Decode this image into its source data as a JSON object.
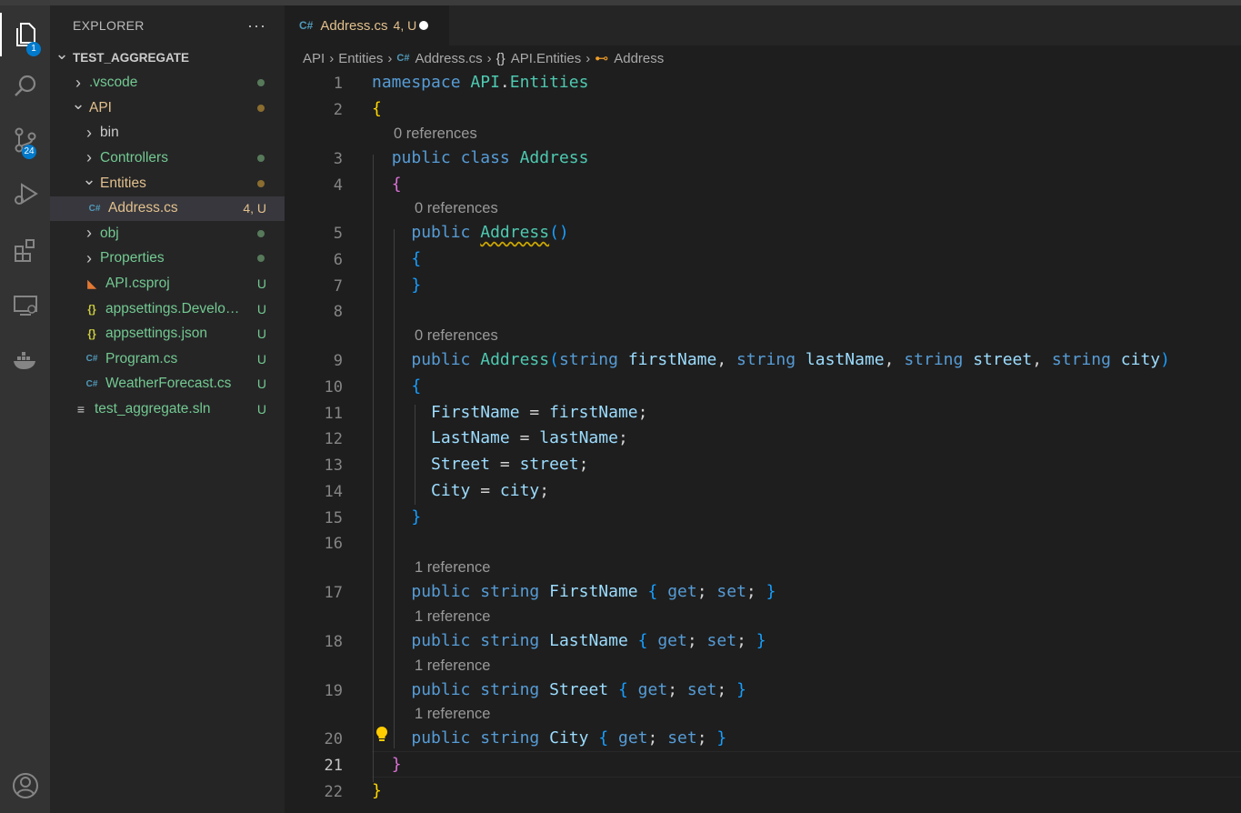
{
  "activity_bar": {
    "explorer_badge": "1",
    "scm_badge": "24"
  },
  "sidebar": {
    "title": "EXPLORER",
    "more": "···",
    "tree": [
      {
        "label": "TEST_AGGREGATE",
        "kind": "root",
        "chev": "down",
        "color": "#cccccc"
      },
      {
        "label": ".vscode",
        "kind": "folder",
        "chev": "right",
        "color": "#73c991",
        "dot": "#577a5a"
      },
      {
        "label": "API",
        "kind": "folder",
        "chev": "down",
        "color": "#e2c08d",
        "dot": "#8a6d2f"
      },
      {
        "label": "bin",
        "kind": "folder",
        "chev": "right",
        "color": "#cccccc"
      },
      {
        "label": "Controllers",
        "kind": "folder",
        "chev": "right",
        "color": "#73c991",
        "dot": "#577a5a"
      },
      {
        "label": "Entities",
        "kind": "folder",
        "chev": "down",
        "color": "#e2c08d",
        "dot": "#8a6d2f"
      },
      {
        "label": "Address.cs",
        "kind": "cs",
        "color": "#e2c08d",
        "status": "4, U",
        "status_color": "#e2c08d",
        "selected": true
      },
      {
        "label": "obj",
        "kind": "folder",
        "chev": "right",
        "color": "#73c991",
        "dot": "#577a5a"
      },
      {
        "label": "Properties",
        "kind": "folder",
        "chev": "right",
        "color": "#73c991",
        "dot": "#577a5a"
      },
      {
        "label": "API.csproj",
        "kind": "rss",
        "color": "#73c991",
        "status": "U",
        "status_color": "#73c991"
      },
      {
        "label": "appsettings.Develop...",
        "kind": "json",
        "color": "#73c991",
        "status": "U",
        "status_color": "#73c991"
      },
      {
        "label": "appsettings.json",
        "kind": "json",
        "color": "#73c991",
        "status": "U",
        "status_color": "#73c991"
      },
      {
        "label": "Program.cs",
        "kind": "cs",
        "color": "#73c991",
        "status": "U",
        "status_color": "#73c991"
      },
      {
        "label": "WeatherForecast.cs",
        "kind": "cs",
        "color": "#73c991",
        "status": "U",
        "status_color": "#73c991"
      },
      {
        "label": "test_aggregate.sln",
        "kind": "sln",
        "color": "#73c991",
        "status": "U",
        "status_color": "#73c991"
      }
    ]
  },
  "tab": {
    "name": "Address.cs",
    "status": "4, U"
  },
  "breadcrumbs": {
    "p1": "API",
    "p2": "Entities",
    "p3": "Address.cs",
    "p4": "API.Entities",
    "p5": "Address"
  },
  "code": {
    "lenses": {
      "class": "0 references",
      "ctor1": "0 references",
      "ctor2": "0 references",
      "p1": "1 reference",
      "p2": "1 reference",
      "p3": "1 reference",
      "p4": "1 reference"
    },
    "line_numbers": [
      "1",
      "2",
      "3",
      "4",
      "5",
      "6",
      "7",
      "8",
      "9",
      "10",
      "11",
      "12",
      "13",
      "14",
      "15",
      "16",
      "17",
      "18",
      "19",
      "20",
      "21",
      "22"
    ],
    "current_line": "21",
    "tokens": {
      "namespace": "namespace",
      "ns_api": "API",
      "dot": ".",
      "ns_entities": "Entities",
      "public": "public",
      "class": "class",
      "Address": "Address",
      "string": "string",
      "firstName": "firstName",
      "lastName": "lastName",
      "street": "street",
      "city": "city",
      "FirstName": "FirstName",
      "LastName": "LastName",
      "Street": "Street",
      "City": "City",
      "get": "get",
      "set": "set"
    }
  }
}
